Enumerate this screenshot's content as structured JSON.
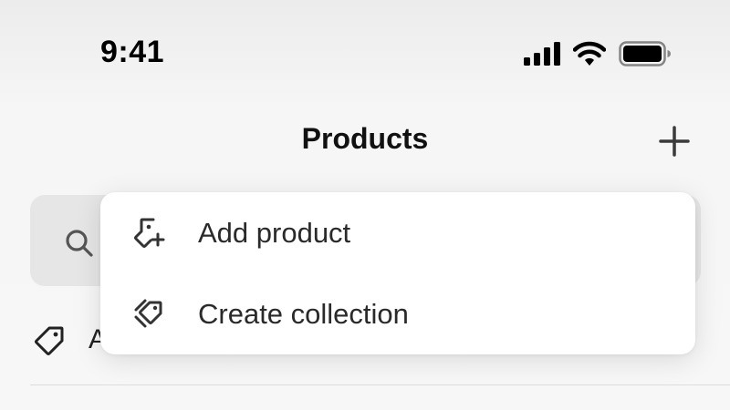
{
  "status_bar": {
    "time": "9:41"
  },
  "nav": {
    "title": "Products"
  },
  "list": {
    "row_label_partial": "A"
  },
  "menu": {
    "items": [
      {
        "label": "Add product",
        "icon": "tag-plus-icon"
      },
      {
        "label": "Create collection",
        "icon": "tags-collection-icon"
      }
    ]
  },
  "colors": {
    "menu_bg": "#ffffff",
    "search_bg": "#e6e6e6",
    "text": "#2a2a2a"
  }
}
